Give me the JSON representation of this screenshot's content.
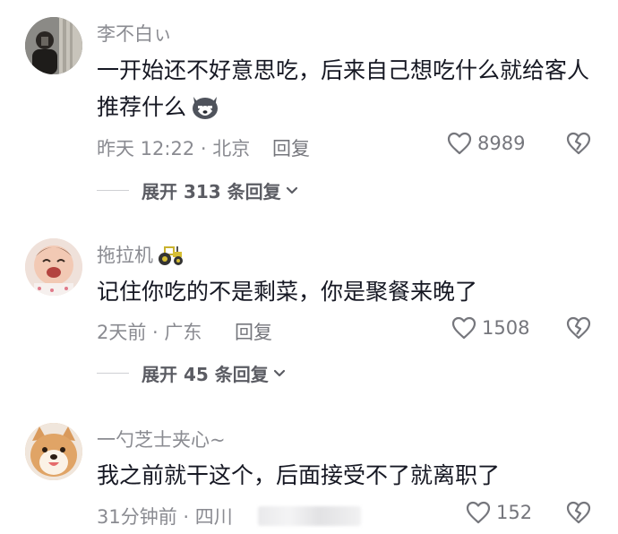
{
  "comments": [
    {
      "username": "李不白ぃ",
      "text": "一开始还不好意思吃，后来自己想吃什么就给客人推荐什么",
      "time_location": "昨天 12:22 · 北京",
      "reply_label": "回复",
      "likes": "8989",
      "expand_label": "展开 313 条回复",
      "emoji": "husky-emoji"
    },
    {
      "username": "拖拉机",
      "text": "记住你吃的不是剩菜，你是聚餐来晚了",
      "time_location": "2天前 · 广东",
      "reply_label": "回复",
      "likes": "1508",
      "expand_label": "展开 45 条回复",
      "emoji": "tractor-emoji"
    },
    {
      "username": "一勺芝士夹心~",
      "text": "我之前就干这个，后面接受不了就离职了",
      "time_location": "31分钟前 · 四川",
      "reply_label": "回复",
      "likes": "152"
    }
  ],
  "colors": {
    "text": "#161823",
    "secondary": "#8a8b91",
    "icon": "#75767c",
    "background": "#ffffff"
  },
  "icons": {
    "like": "heart-outline-icon",
    "dislike": "broken-heart-icon",
    "expand": "chevron-down-icon"
  }
}
